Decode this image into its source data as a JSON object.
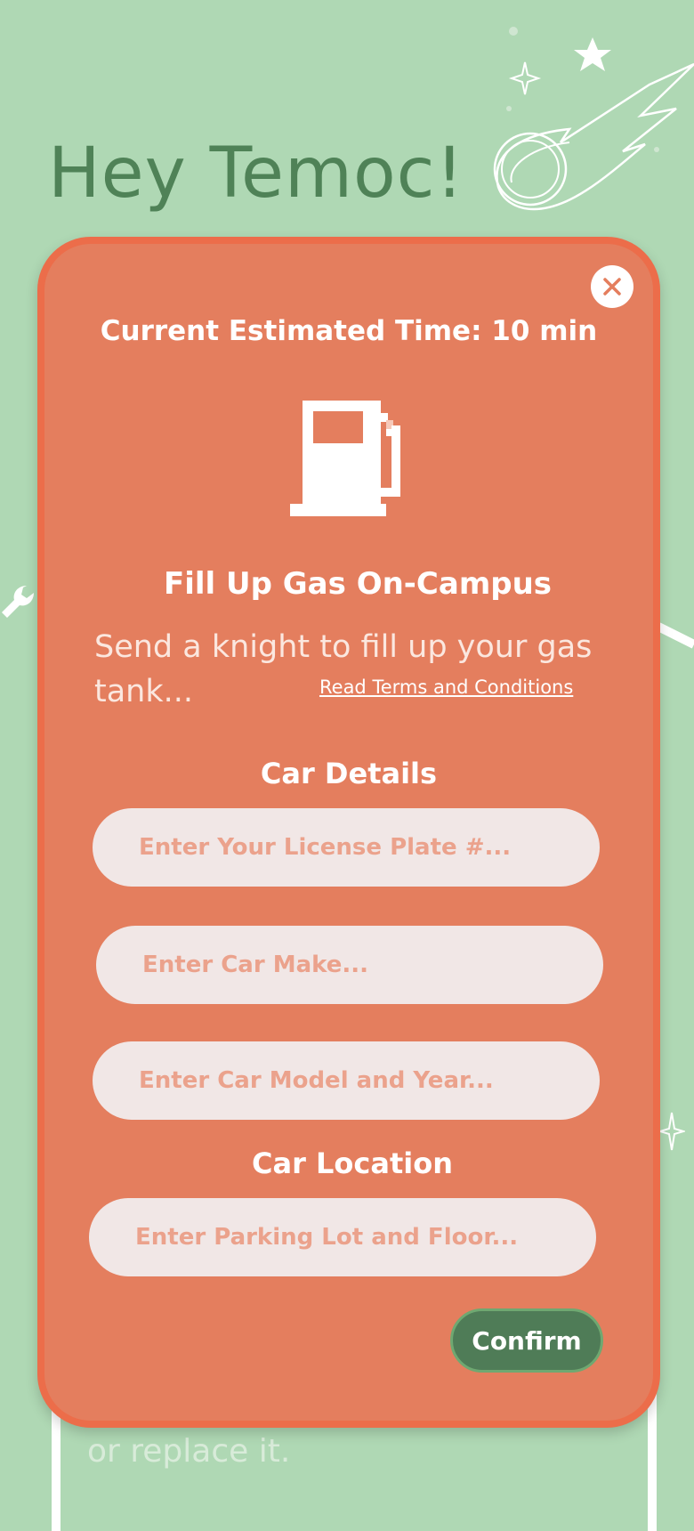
{
  "greeting": "Hey Temoc!",
  "background_text": "or replace it.",
  "modal": {
    "estimated_time": "Current Estimated Time: 10 min",
    "service_icon": "gas-pump-icon",
    "service_title": "Fill Up Gas On-Campus",
    "service_description": "Send a knight to fill up your gas tank...",
    "terms_link": "Read Terms and Conditions",
    "car_details_label": "Car Details",
    "license_placeholder": "Enter Your License Plate #...",
    "make_placeholder": "Enter Car Make...",
    "model_placeholder": "Enter Car Model and Year...",
    "car_location_label": "Car Location",
    "location_placeholder": "Enter Parking Lot and Floor...",
    "confirm_label": "Confirm",
    "close_icon": "close-icon"
  },
  "colors": {
    "background": "#afd8b4",
    "modal": "#e47e5e",
    "modal_border": "#ec6d4a",
    "confirm": "#4f7c57",
    "field": "#f1e7e6"
  }
}
